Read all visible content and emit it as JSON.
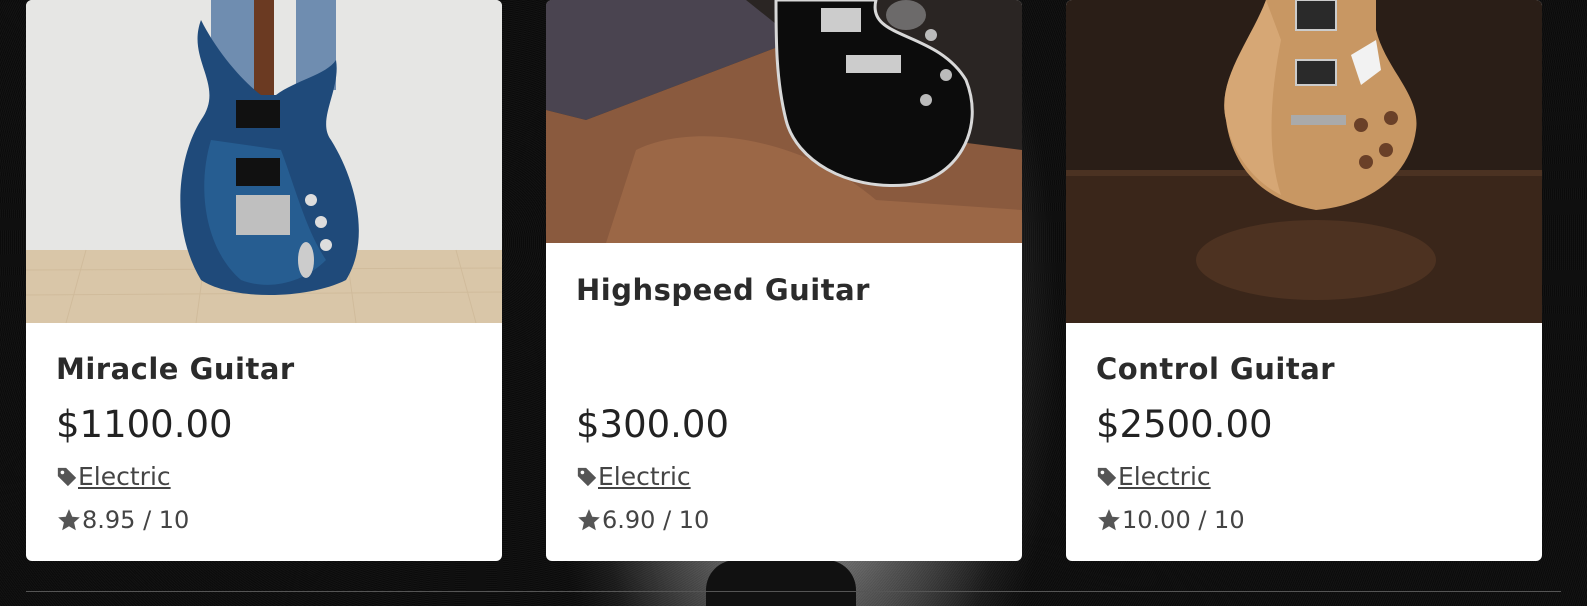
{
  "cards": [
    {
      "title": "Miracle Guitar",
      "price": "$1100.00",
      "category": "Electric",
      "rating": "8.95 / 10"
    },
    {
      "title": "Highspeed Guitar",
      "price": "$300.00",
      "category": "Electric",
      "rating": "6.90 / 10"
    },
    {
      "title": "Control Guitar",
      "price": "$2500.00",
      "category": "Electric",
      "rating": "10.00 / 10"
    }
  ],
  "icons": {
    "category": "tag-icon",
    "rating": "star-icon"
  },
  "colors": {
    "card_bg": "#ffffff",
    "text": "#2b2b2b",
    "link": "#444444",
    "page_bg": "#0b0b0b"
  }
}
